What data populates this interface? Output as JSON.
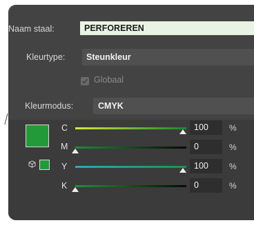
{
  "name_label": "Naam staal:",
  "name_value": "PERFOREREN",
  "kleurtype_label": "Kleurtype:",
  "kleurtype_value": "Steunkleur",
  "global_label": "Globaal",
  "global_checked": true,
  "kleurmodus_label": "Kleurmodus:",
  "kleurmodus_value": "CMYK",
  "swatch_color": "#239a39",
  "channels": [
    {
      "label": "C",
      "value": "100",
      "unit": "%"
    },
    {
      "label": "M",
      "value": "0",
      "unit": "%"
    },
    {
      "label": "Y",
      "value": "100",
      "unit": "%"
    },
    {
      "label": "K",
      "value": "0",
      "unit": "%"
    }
  ],
  "icons": [
    "checkbox-check-icon",
    "out-of-gamut-cube-icon"
  ]
}
